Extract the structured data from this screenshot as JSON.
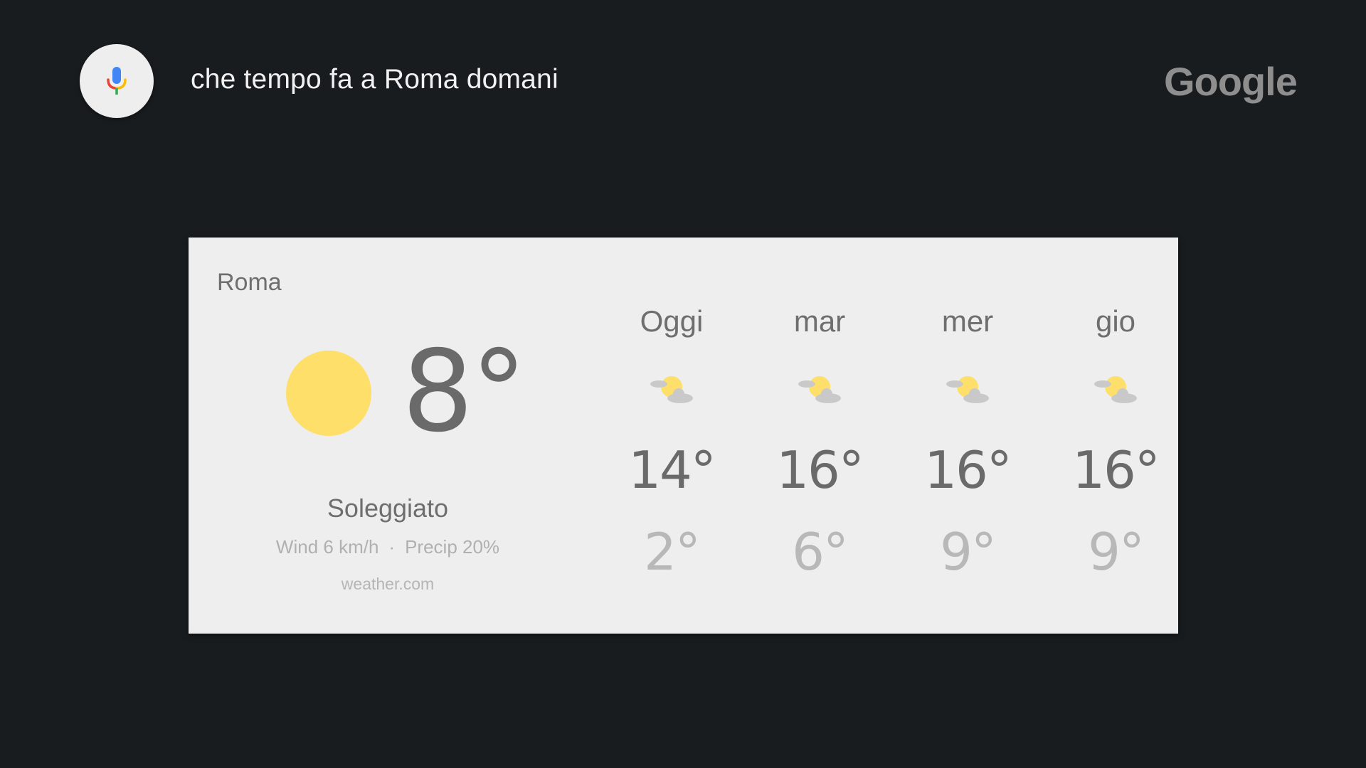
{
  "query": "che tempo fa a Roma domani",
  "brand": "Google",
  "weather": {
    "location": "Roma",
    "current": {
      "temp": "8°",
      "condition": "Soleggiato",
      "wind": "Wind 6 km/h",
      "separator": "·",
      "precip": "Precip 20%",
      "source": "weather.com",
      "icon": "sun-icon"
    },
    "forecast": [
      {
        "day": "Oggi",
        "high": "14°",
        "low": "2°",
        "icon": "partly-cloudy-icon"
      },
      {
        "day": "mar",
        "high": "16°",
        "low": "6°",
        "icon": "partly-cloudy-icon"
      },
      {
        "day": "mer",
        "high": "16°",
        "low": "9°",
        "icon": "partly-cloudy-icon"
      },
      {
        "day": "gio",
        "high": "16°",
        "low": "9°",
        "icon": "partly-cloudy-icon"
      }
    ]
  },
  "colors": {
    "background": "#181c1f",
    "card": "#eeeeee",
    "sun": "#fddf6a",
    "mic_blue": "#4285f4",
    "mic_red": "#ea4335",
    "mic_yellow": "#fbbc05",
    "mic_green": "#34a853"
  }
}
